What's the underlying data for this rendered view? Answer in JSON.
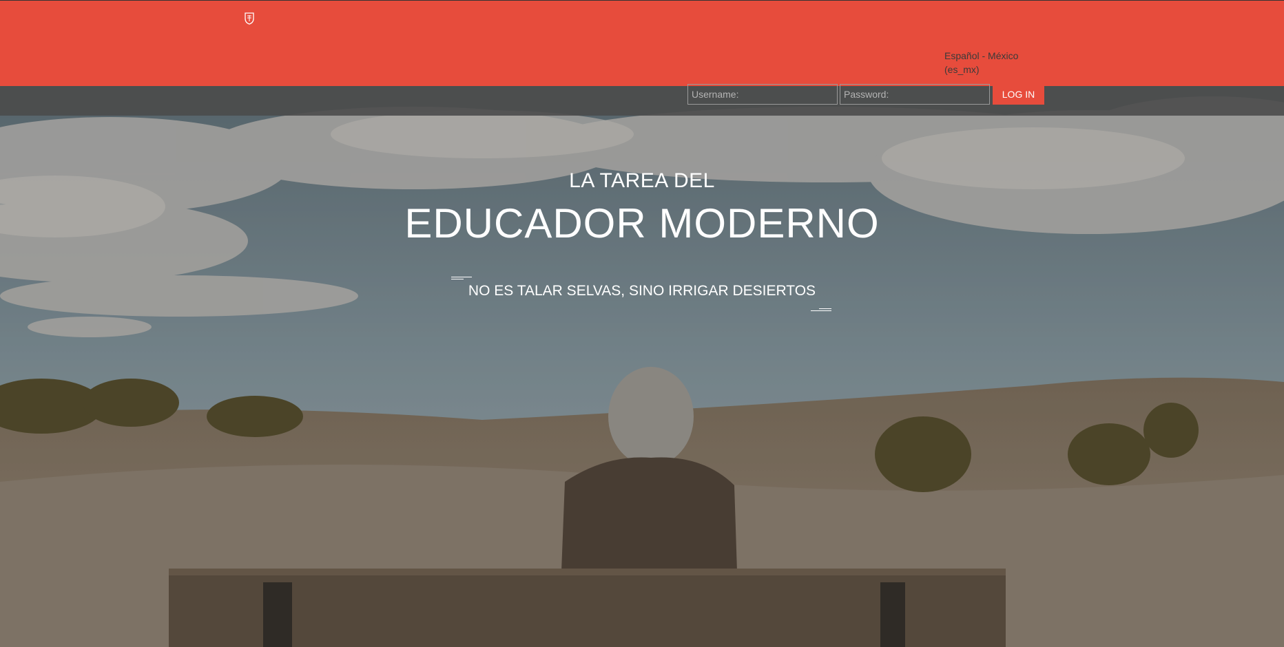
{
  "header": {
    "logo_icon": "crest-logo-icon",
    "language": "Español - México (es_mx)",
    "accent_color": "#e74c3c"
  },
  "login": {
    "username_placeholder": "Username:",
    "password_placeholder": "Password:",
    "username_value": "",
    "password_value": "",
    "submit_label": "LOG IN"
  },
  "hero": {
    "line1": "LA TAREA DEL",
    "line2": "EDUCADOR MODERNO",
    "tagline": "NO ES TALAR SELVAS, SINO IRRIGAR DESIERTOS"
  }
}
